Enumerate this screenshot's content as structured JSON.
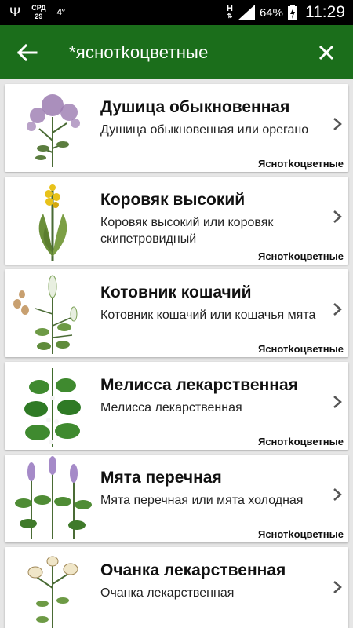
{
  "status_bar": {
    "usb_icon": "usb-icon",
    "day_label": "СРД",
    "day_number": "29",
    "temperature": "4°",
    "network_label": "H",
    "battery_percent": "64%",
    "time": "11:29"
  },
  "toolbar": {
    "search_query": "*яснотkоцветные",
    "back_icon": "arrow-left-icon",
    "close_icon": "close-icon",
    "background_color": "#1b6e1b"
  },
  "plants": [
    {
      "title": "Душица обыкновенная",
      "description": "Душица обыкновенная или орегано",
      "family": "Яснотkоцветные",
      "flower_color": "#9b7bb0"
    },
    {
      "title": "Коровяк высокий",
      "description": "Коровяк высокий или коровяк скипетровидный",
      "family": "Яснотkоцветные",
      "flower_color": "#e8c21a"
    },
    {
      "title": "Котовник кошачий",
      "description": "Котовник кошачий или кошачья мята",
      "family": "Яснотkоцветные",
      "flower_color": "#f2f2f2"
    },
    {
      "title": "Мелисса лекарственная",
      "description": "Мелисса лекарственная",
      "family": "Яснотkоцветные",
      "flower_color": "#f5f5f5"
    },
    {
      "title": "Мята перечная",
      "description": "Мята перечная или мята холодная",
      "family": "Яснотkоцветные",
      "flower_color": "#a58ac8"
    },
    {
      "title": "Очанка лекарственная",
      "description": "Очанка лекарственная",
      "family": "",
      "flower_color": "#f0e6c8"
    }
  ]
}
